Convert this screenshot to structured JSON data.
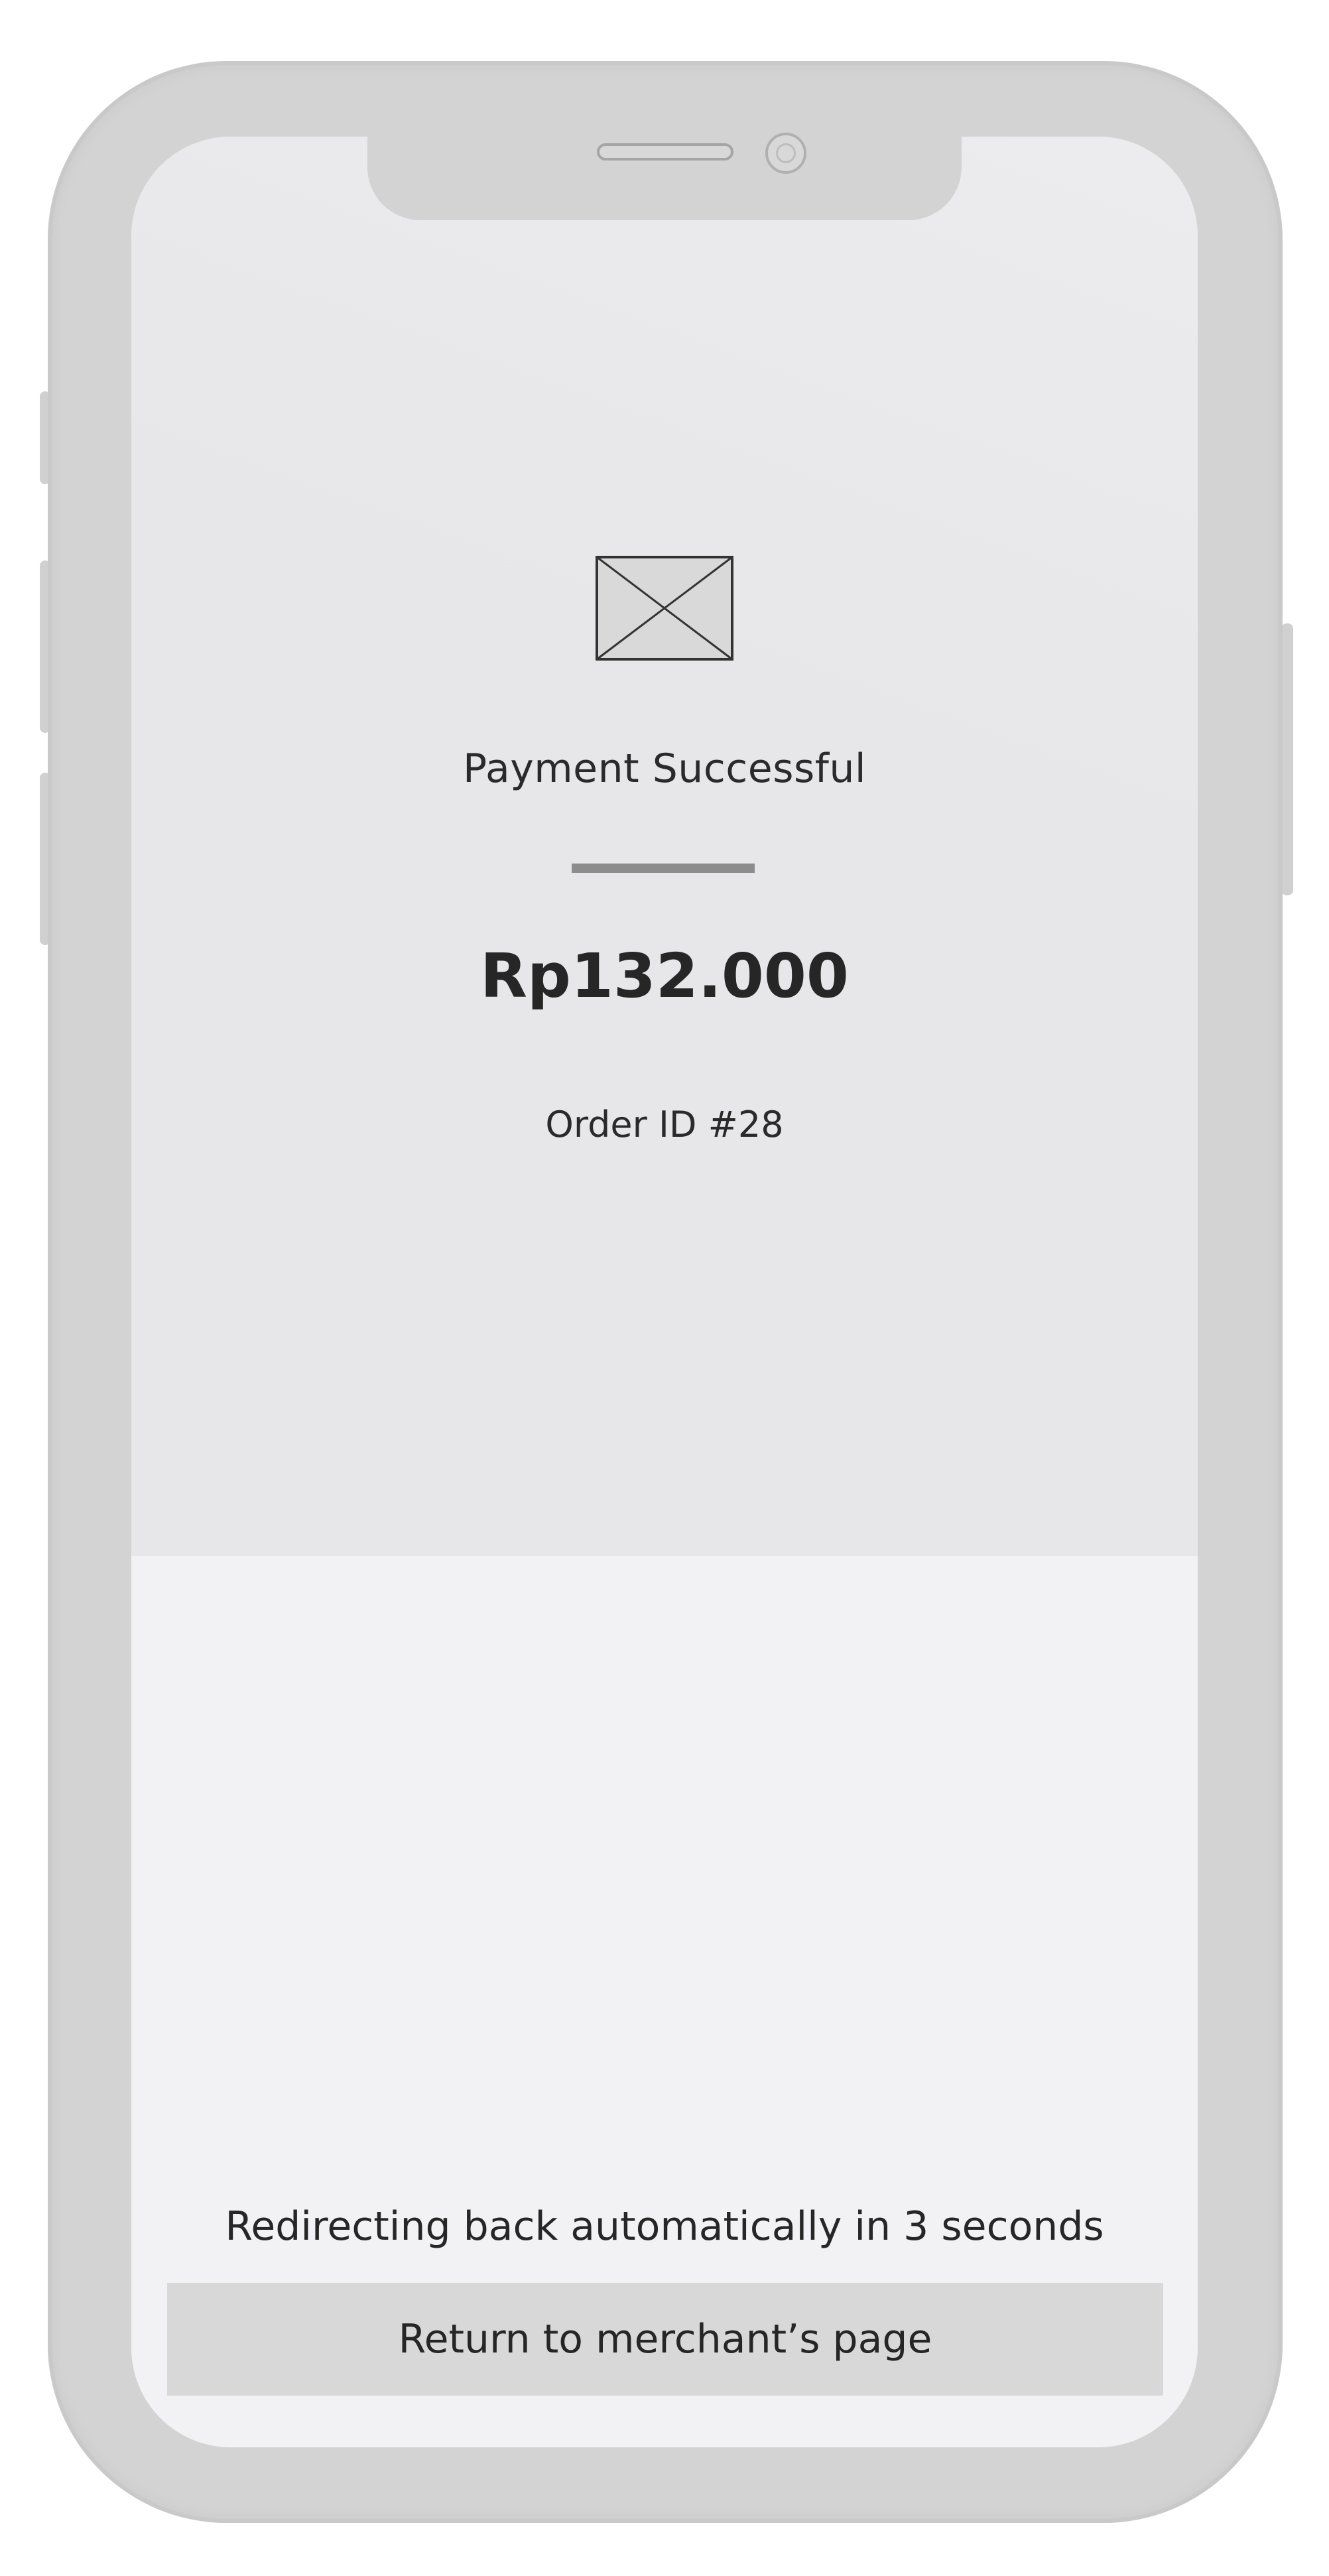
{
  "screen": {
    "title": "Payment Successful",
    "amount": "Rp132.000",
    "order_id": "Order ID #28",
    "redirect_message": "Redirecting back automatically in 3 seconds",
    "return_button_label": "Return to merchant’s page"
  },
  "icons": {
    "hero": "image-placeholder-icon"
  },
  "colors": {
    "screen_top_bg": "#e7e7e9",
    "screen_bottom_bg": "#f2f2f4",
    "button_bg": "#d8d8d8",
    "divider": "#8c8c8c",
    "text": "#262626"
  }
}
